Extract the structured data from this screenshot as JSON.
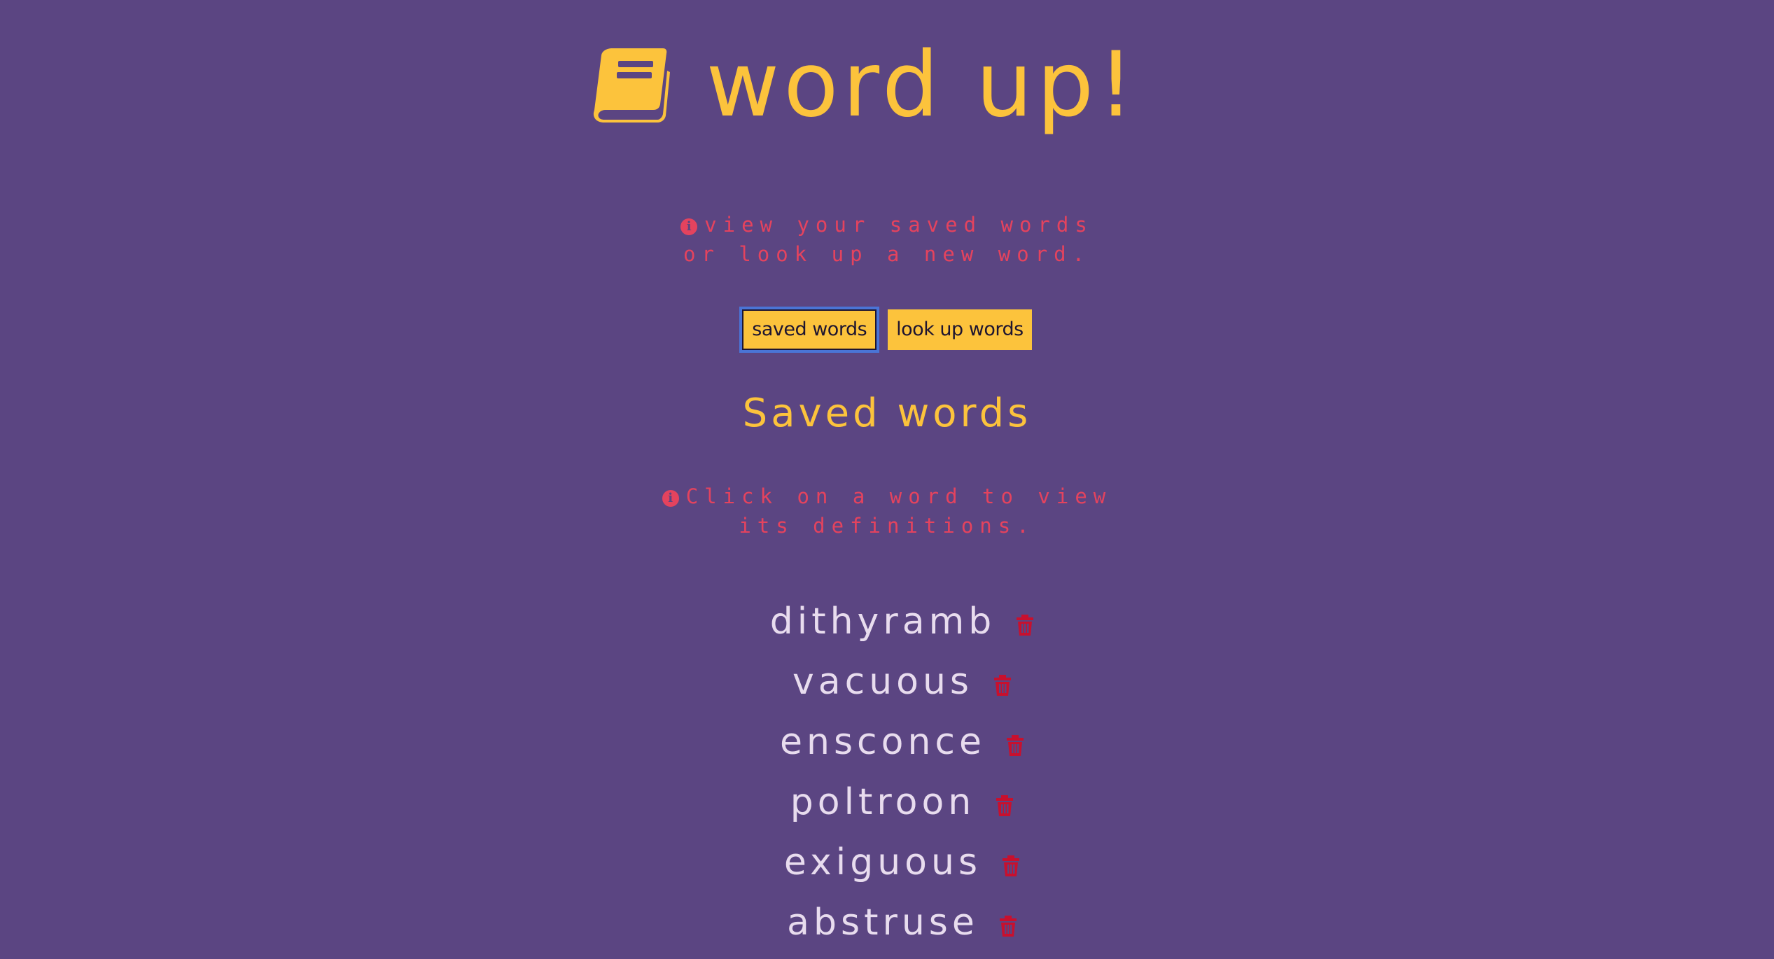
{
  "app": {
    "title": "word up!",
    "icon": "book-icon"
  },
  "intro_hint": {
    "icon": "info-icon",
    "line1": "view your saved words",
    "line2": "or look up a new word."
  },
  "nav": {
    "saved_label": "saved words",
    "lookup_label": "look up words",
    "active": "saved words"
  },
  "saved_section": {
    "title": "Saved words",
    "hint_line1": "Click on a word to view",
    "hint_line2": "its definitions.",
    "words": [
      "dithyramb",
      "vacuous",
      "ensconce",
      "poltroon",
      "exiguous",
      "abstruse"
    ],
    "delete_icon": "trash-icon"
  },
  "colors": {
    "background": "#5b4582",
    "accent": "#fcc33c",
    "hint": "#e4435e",
    "word": "#e8dcee",
    "delete": "#c8102e"
  }
}
